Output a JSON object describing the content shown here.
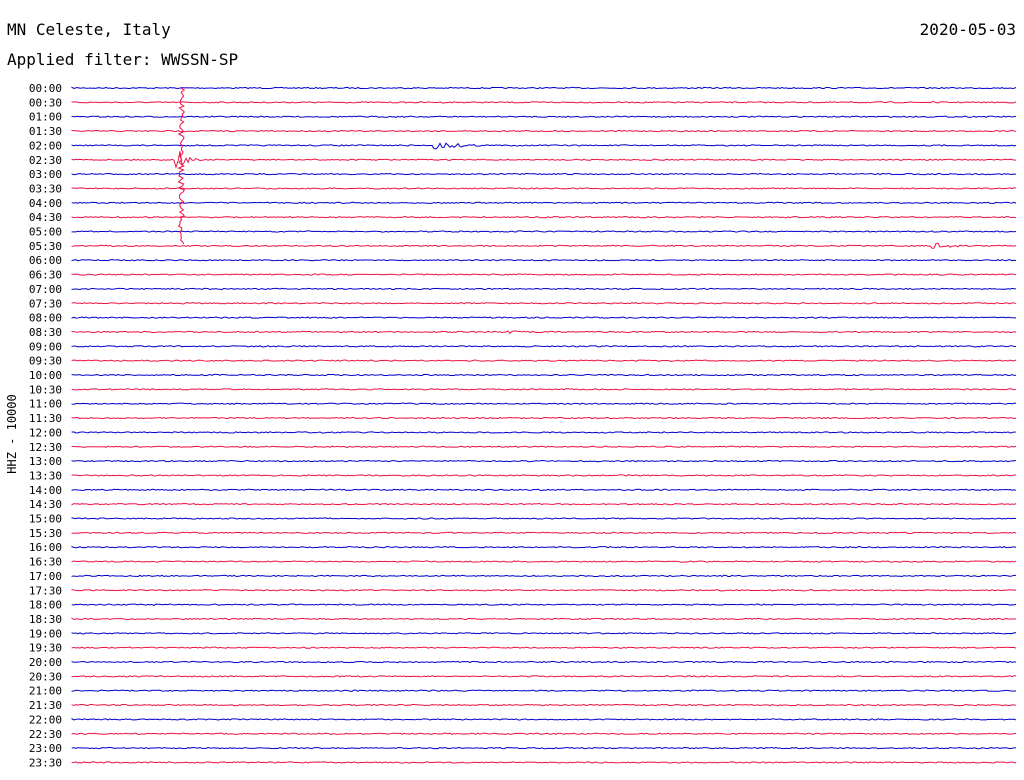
{
  "header": {
    "station": "MN Celeste, Italy",
    "date": "2020-05-03",
    "filter": "Applied filter: WWSSN-SP"
  },
  "chart_data": {
    "type": "line",
    "title": "MN Celeste, Italy",
    "ylabel": "HHZ - 10000",
    "rows": [
      "00:00",
      "00:30",
      "01:00",
      "01:30",
      "02:00",
      "02:30",
      "03:00",
      "03:30",
      "04:00",
      "04:30",
      "05:00",
      "05:30",
      "06:00",
      "06:30",
      "07:00",
      "07:30",
      "08:00",
      "08:30",
      "09:00",
      "09:30",
      "10:00",
      "10:30",
      "11:00",
      "11:30",
      "12:00",
      "12:30",
      "13:00",
      "13:30",
      "14:00",
      "14:30",
      "15:00",
      "15:30",
      "16:00",
      "16:30",
      "17:00",
      "17:30",
      "18:00",
      "18:30",
      "19:00",
      "19:30",
      "20:00",
      "20:30",
      "21:00",
      "21:30",
      "22:00",
      "22:30",
      "23:00",
      "23:30"
    ],
    "colors": [
      "#0000cc",
      "#ee1144"
    ],
    "events": [
      {
        "row": "02:00",
        "at": 0.38,
        "span": 0.09,
        "amp": 5
      },
      {
        "row": "02:30",
        "at": 0.11,
        "span": 0.03,
        "amp": 14
      },
      {
        "row": "05:30",
        "at": 0.91,
        "span": 0.07,
        "amp": 4
      },
      {
        "row": "08:30",
        "at": 0.46,
        "span": 0.04,
        "amp": 2
      },
      {
        "row": "18:00",
        "at": 0.08,
        "span": 0.04,
        "amp": 2
      }
    ]
  }
}
